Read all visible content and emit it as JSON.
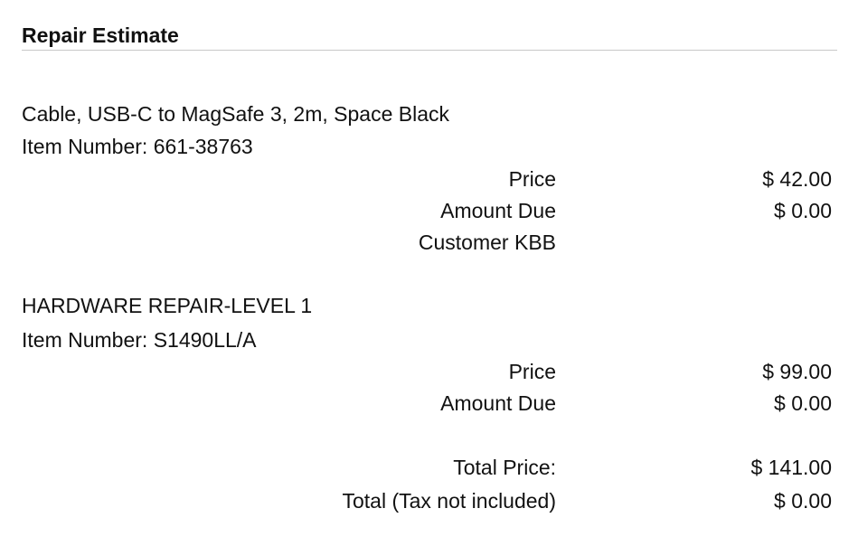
{
  "estimate": {
    "title": "Repair Estimate",
    "items": [
      {
        "name": "Cable, USB-C to MagSafe 3, 2m, Space Black",
        "item_number": "Item Number: 661-38763",
        "price_label": "Price",
        "price_value": "$ 42.00",
        "amount_due_label": "Amount Due",
        "amount_due_value": "$ 0.00",
        "note": "Customer KBB"
      },
      {
        "name": "HARDWARE REPAIR-LEVEL 1",
        "item_number": "Item Number: S1490LL/A",
        "price_label": "Price",
        "price_value": "$ 99.00",
        "amount_due_label": "Amount Due",
        "amount_due_value": "$ 0.00"
      }
    ],
    "totals": {
      "total_price_label": "Total Price:",
      "total_price_value": "$ 141.00",
      "total_label": "Total (Tax not included)",
      "total_value": "$ 0.00"
    }
  }
}
